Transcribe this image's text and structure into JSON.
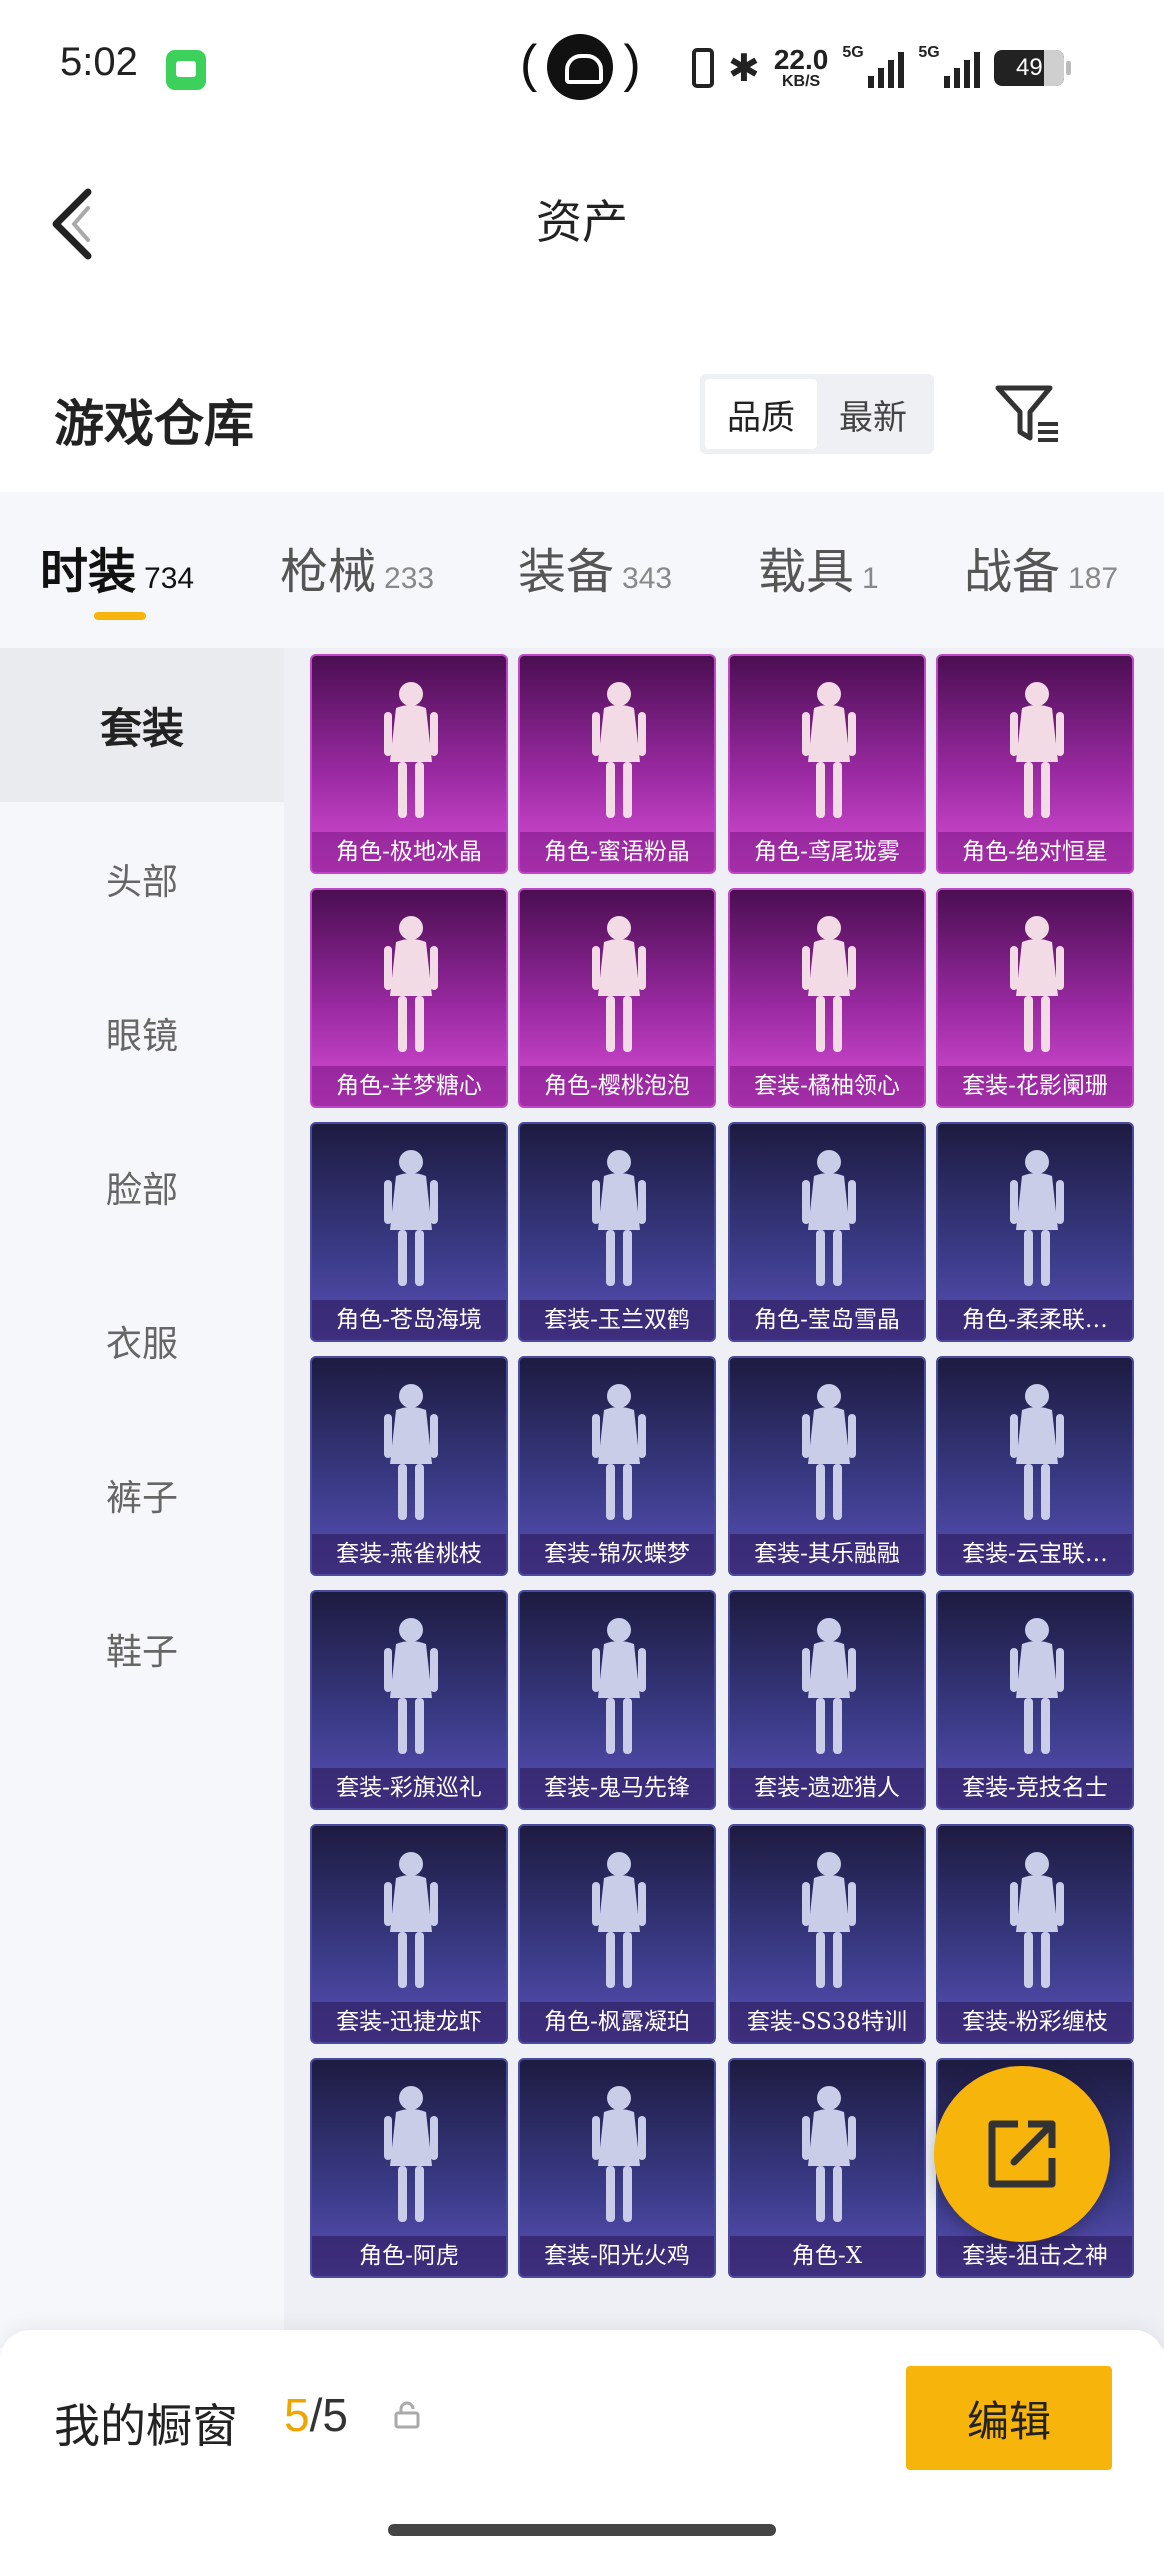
{
  "status_bar": {
    "time": "5:02",
    "speed_value": "22.0",
    "speed_unit": "KB/S",
    "network_1": "5G",
    "network_2": "5G",
    "battery": "49"
  },
  "header": {
    "title": "资产"
  },
  "section": {
    "title": "游戏仓库",
    "sort_options": [
      "品质",
      "最新"
    ],
    "active_sort": "品质"
  },
  "tabs": [
    {
      "label": "时装",
      "count": "734",
      "active": true
    },
    {
      "label": "枪械",
      "count": "233"
    },
    {
      "label": "装备",
      "count": "343"
    },
    {
      "label": "载具",
      "count": "1"
    },
    {
      "label": "战备",
      "count": "187"
    }
  ],
  "sidebar": {
    "items": [
      "套装",
      "头部",
      "眼镜",
      "脸部",
      "衣服",
      "裤子",
      "鞋子"
    ],
    "active": "套装"
  },
  "items": [
    {
      "label": "角色-极地冰晶",
      "rarity": "pink"
    },
    {
      "label": "角色-蜜语粉晶",
      "rarity": "pink"
    },
    {
      "label": "角色-鸢尾珑雾",
      "rarity": "pink"
    },
    {
      "label": "角色-绝对恒星",
      "rarity": "pink"
    },
    {
      "label": "角色-羊梦糖心",
      "rarity": "pink"
    },
    {
      "label": "角色-樱桃泡泡",
      "rarity": "pink"
    },
    {
      "label": "套装-橘柚领心",
      "rarity": "pink"
    },
    {
      "label": "套装-花影阑珊",
      "rarity": "pink"
    },
    {
      "label": "角色-苍岛海境",
      "rarity": "purple"
    },
    {
      "label": "套装-玉兰双鹤",
      "rarity": "purple"
    },
    {
      "label": "角色-莹岛雪晶",
      "rarity": "purple"
    },
    {
      "label": "角色-柔柔联…",
      "rarity": "purple"
    },
    {
      "label": "套装-燕雀桃枝",
      "rarity": "purple"
    },
    {
      "label": "套装-锦灰蝶梦",
      "rarity": "purple"
    },
    {
      "label": "套装-其乐融融",
      "rarity": "purple"
    },
    {
      "label": "套装-云宝联…",
      "rarity": "purple"
    },
    {
      "label": "套装-彩旗巡礼",
      "rarity": "purple"
    },
    {
      "label": "套装-鬼马先锋",
      "rarity": "purple"
    },
    {
      "label": "套装-遗迹猎人",
      "rarity": "purple"
    },
    {
      "label": "套装-竞技名士",
      "rarity": "purple"
    },
    {
      "label": "套装-迅捷龙虾",
      "rarity": "purple"
    },
    {
      "label": "角色-枫露凝珀",
      "rarity": "purple"
    },
    {
      "label": "套装-SS38特训",
      "rarity": "purple"
    },
    {
      "label": "套装-粉彩缠枝",
      "rarity": "purple"
    },
    {
      "label": "角色-阿虎",
      "rarity": "purple"
    },
    {
      "label": "套装-阳光火鸡",
      "rarity": "purple"
    },
    {
      "label": "角色-X",
      "rarity": "purple"
    },
    {
      "label": "套装-狙击之神",
      "rarity": "purple"
    }
  ],
  "bottom_bar": {
    "label": "我的橱窗",
    "count_current": "5",
    "count_total": "/5",
    "edit_label": "编辑"
  },
  "colors": {
    "accent": "#f7b40a",
    "rarity_pink": "#9b2aa3",
    "rarity_purple": "#3b3b88"
  }
}
